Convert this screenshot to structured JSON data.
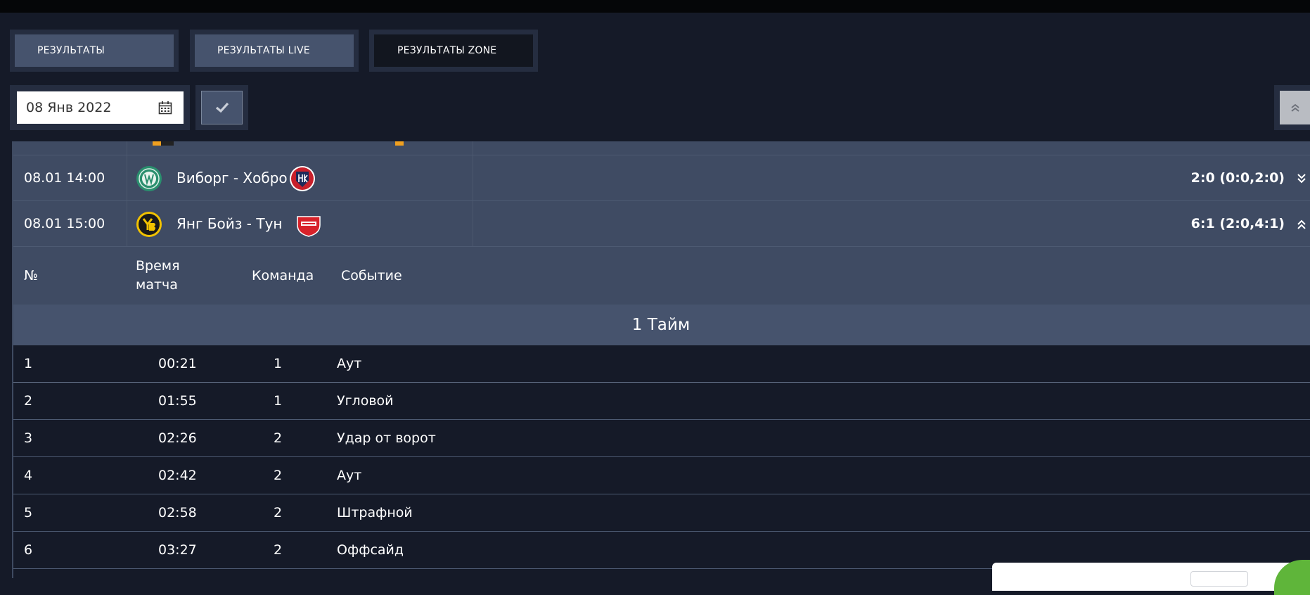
{
  "tabs": [
    {
      "label": "РЕЗУЛЬТАТЫ"
    },
    {
      "label": "РЕЗУЛЬТАТЫ LIVE"
    },
    {
      "label": "РЕЗУЛЬТАТЫ ZONE"
    }
  ],
  "date_filter": {
    "value": "08 Янв 2022",
    "calendar_icon": "calendar-icon"
  },
  "confirm_button": {
    "icon": "check-icon"
  },
  "collapse_button": {
    "icon": "double-chevron-up-icon"
  },
  "matches": [
    {
      "time": "08.01 14:00",
      "teams": "Виборг - Хобро",
      "score": "2:0 (0:0,2:0)",
      "expanded": false
    },
    {
      "time": "08.01 15:00",
      "teams": "Янг Бойз - Тун",
      "score": "6:1 (2:0,4:1)",
      "expanded": true
    }
  ],
  "events_table": {
    "headers": {
      "number": "№",
      "match_time": "Время матча",
      "team": "Команда",
      "event": "Событие"
    },
    "period_label": "1 Тайм",
    "rows": [
      {
        "n": "1",
        "time": "00:21",
        "team": "1",
        "event": "Аут"
      },
      {
        "n": "2",
        "time": "01:55",
        "team": "1",
        "event": "Угловой"
      },
      {
        "n": "3",
        "time": "02:26",
        "team": "2",
        "event": "Удар от ворот"
      },
      {
        "n": "4",
        "time": "02:42",
        "team": "2",
        "event": "Аут"
      },
      {
        "n": "5",
        "time": "02:58",
        "team": "2",
        "event": "Штрафной"
      },
      {
        "n": "6",
        "time": "03:27",
        "team": "2",
        "event": "Оффсайд"
      }
    ]
  },
  "colors": {
    "background": "#151a28",
    "row_background": "#3f4b63",
    "period_background": "#46536d",
    "accent_green": "#5fb53a"
  }
}
